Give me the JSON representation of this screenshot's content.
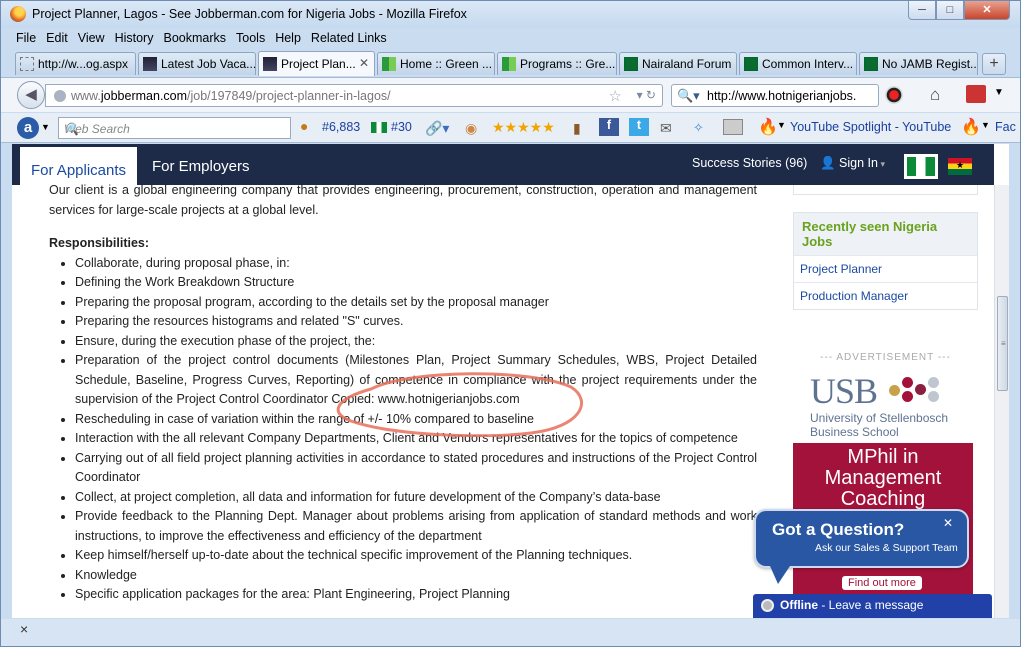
{
  "window": {
    "title": "Project Planner, Lagos - See Jobberman.com for Nigeria Jobs - Mozilla Firefox",
    "buttons": [
      "─",
      "□",
      "✕"
    ]
  },
  "menu": [
    "File",
    "Edit",
    "View",
    "History",
    "Bookmarks",
    "Tools",
    "Help",
    "Related Links"
  ],
  "tabs": [
    {
      "label": "http://w...og.aspx",
      "active": false
    },
    {
      "label": "Latest Job Vaca...",
      "active": false
    },
    {
      "label": "Project Plan...",
      "active": true
    },
    {
      "label": "Home :: Green ...",
      "active": false
    },
    {
      "label": "Programs :: Gre...",
      "active": false
    },
    {
      "label": "Nairaland Forum",
      "active": false
    },
    {
      "label": "Common Interv...",
      "active": false
    },
    {
      "label": "No JAMB Regist...",
      "active": false
    }
  ],
  "newtab_label": "+",
  "urlbar": {
    "domain_prefix": "www.",
    "domain": "jobberman.com",
    "path": "/job/197849/project-planner-in-lagos/"
  },
  "searchbar": {
    "value": "http://www.hotnigerianjobs."
  },
  "toolbar": {
    "websearch_placeholder": "Web Search",
    "rank": "#6,883",
    "rank2": "#30",
    "stars": "★★★★★",
    "youtube": "YouTube Spotlight - YouTube",
    "fac": "Fac"
  },
  "site": {
    "nav_applicants": "For Applicants",
    "nav_employers": "For Employers",
    "success_stories": "Success Stories (96)",
    "sign_in": "Sign In",
    "intro": "Our client is a global engineering company that provides engineering, procurement, construction, operation and management services for large-scale projects at a global level.",
    "responsibilities_title": "Responsibilities:",
    "responsibilities": [
      "Collaborate, during proposal phase, in:",
      "Defining the Work Breakdown Structure",
      "Preparing the proposal program, according to the details set by the proposal manager",
      "Preparing the resources histograms and related \"S\" curves.",
      "Ensure, during the execution phase of the project, the:",
      "Preparation of the project control documents (Milestones Plan, Project Summary Schedules, WBS, Project Detailed Schedule, Baseline, Progress Curves, Reporting) of competence in compliance with the project requirements under the supervision of the Project Control Coordinator Copied: www.hotnigerianjobs.com",
      "Rescheduling in case of variation within the range of +/- 10% compared to baseline",
      "Interaction with the all relevant Company Departments, Client and Vendors representatives for the topics of competence",
      "Carrying out of all field project planning activities in accordance to stated procedures and instructions of the Project Control Coordinator",
      "Collect, at project completion, all data and information for future development of the Company’s data-base",
      "Provide feedback to the Planning Dept. Manager about problems arising from application of standard methods and work instructions, to improve the effectiveness and efficiency of the department",
      "Keep himself/herself up-to-date about the technical specific improvement of the Planning techniques.",
      "Knowledge",
      "Specific application packages for the area: Plant Engineering, Project Planning"
    ],
    "recent_title": "Recently seen Nigeria Jobs",
    "recent_jobs": [
      "Project Planner",
      "Production Manager"
    ],
    "ad_label": "--- ADVERTISEMENT ---",
    "usb_logo": "USB",
    "usb_name": "University of Stellenbosch",
    "usb_school": "Business School",
    "ad_text": "MPhil in Management Coaching",
    "find_more": "Find out more",
    "chat_title": "Got a Question?",
    "chat_sub": "Ask our Sales & Support Team",
    "offline_status": "Offline",
    "offline_msg": " - Leave a message"
  },
  "colors": {
    "nav_bg": "#1d2a48",
    "link": "#1b4aa2",
    "sidebar_head": "#6aa11e",
    "ad_red": "#a3123a",
    "chat_blue": "#2957a4",
    "annotation": "#e8705a"
  }
}
